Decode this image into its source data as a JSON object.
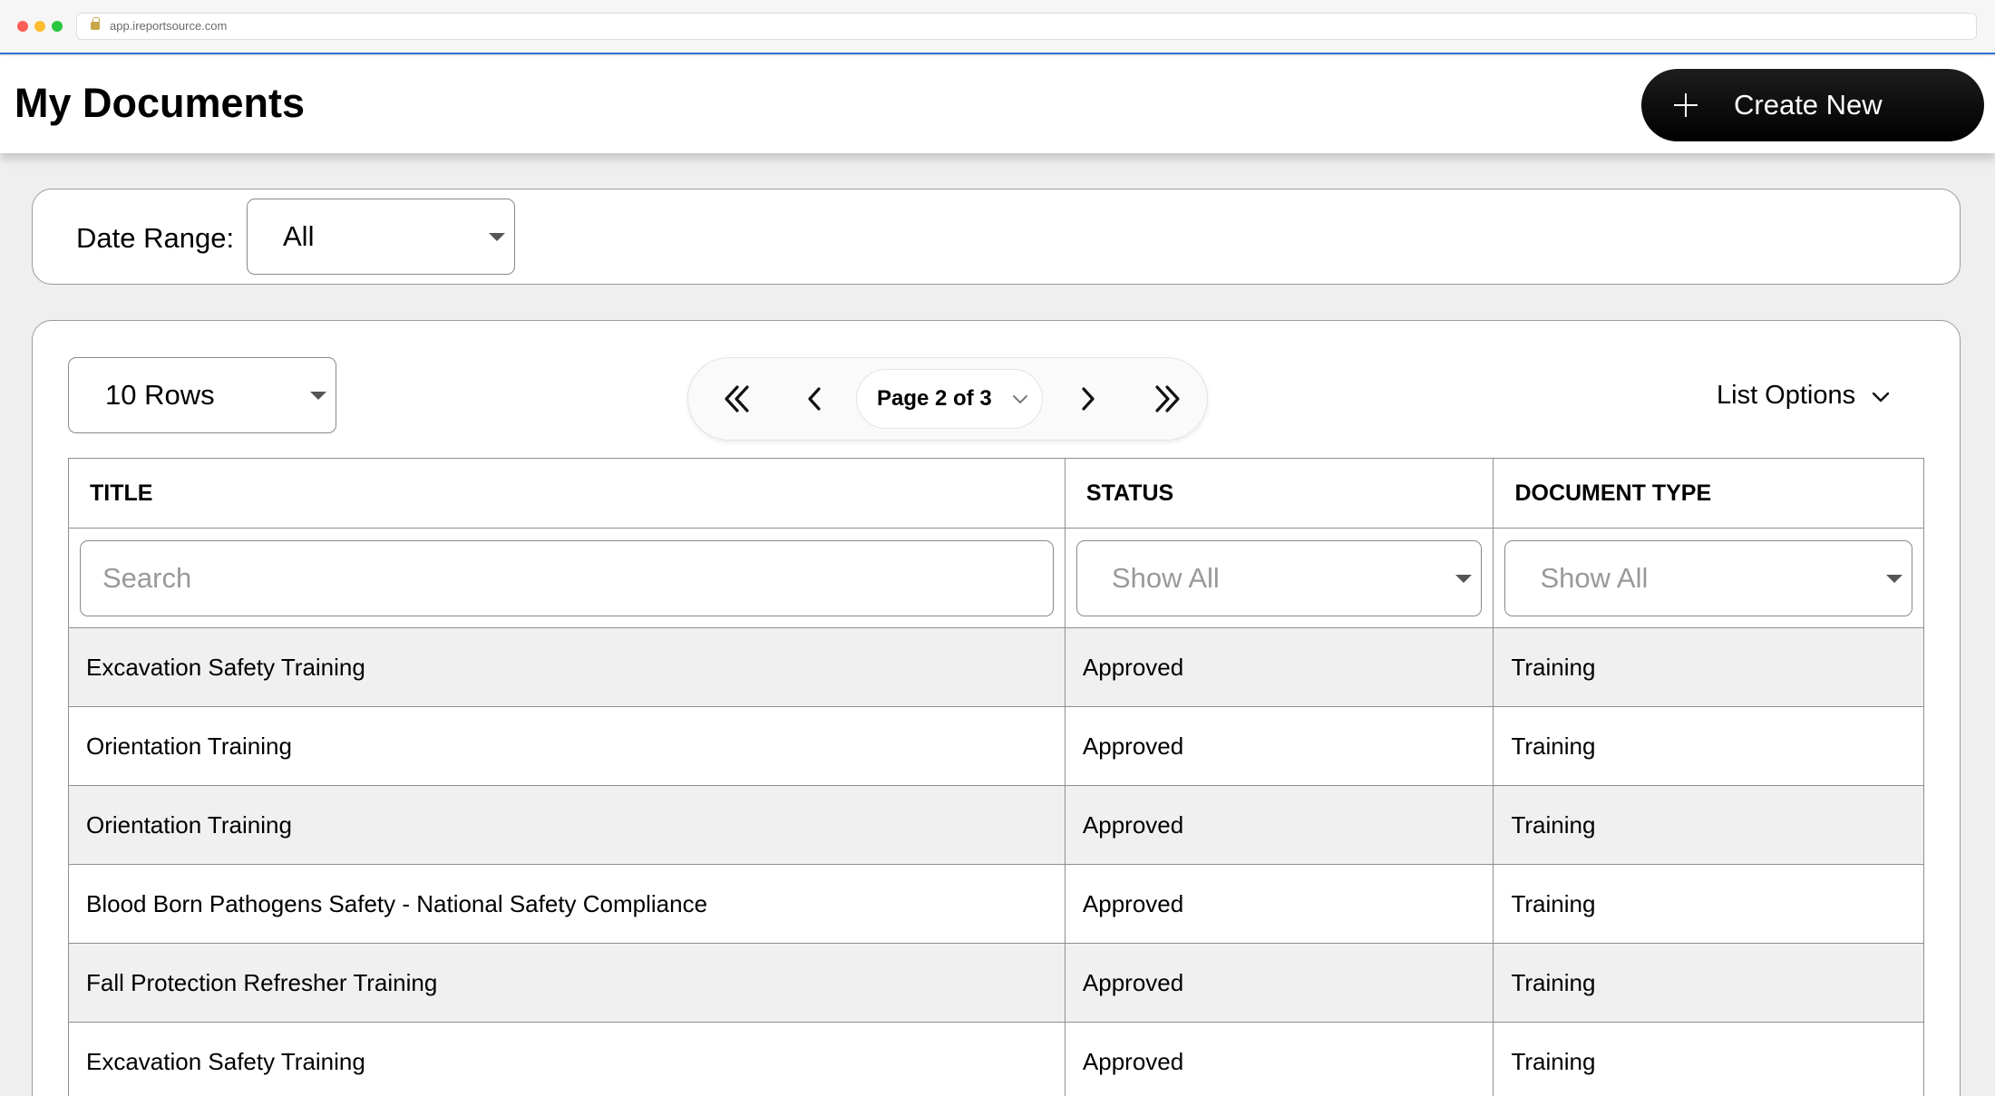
{
  "browser": {
    "url": "app.ireportsource.com"
  },
  "header": {
    "title": "My Documents",
    "create_label": "Create New"
  },
  "filters": {
    "date_range_label": "Date Range:",
    "date_range_value": "All"
  },
  "list": {
    "rows_per_page": "10 Rows",
    "page_indicator": "Page 2 of 3",
    "list_options_label": "List Options",
    "columns": [
      "TITLE",
      "STATUS",
      "DOCUMENT TYPE"
    ],
    "search_placeholder": "Search",
    "status_filter": "Show All",
    "type_filter": "Show All",
    "rows": [
      {
        "title": "Excavation Safety Training",
        "status": "Approved",
        "type": "Training"
      },
      {
        "title": "Orientation Training",
        "status": "Approved",
        "type": "Training"
      },
      {
        "title": "Orientation Training",
        "status": "Approved",
        "type": "Training"
      },
      {
        "title": "Blood Born Pathogens Safety - National Safety Compliance",
        "status": "Approved",
        "type": "Training"
      },
      {
        "title": "Fall Protection Refresher Training",
        "status": "Approved",
        "type": "Training"
      },
      {
        "title": "Excavation Safety Training",
        "status": "Approved",
        "type": "Training"
      }
    ]
  },
  "icons": {
    "lock": "lock-icon",
    "plus": "plus-icon",
    "first": "double-chevron-left-icon",
    "prev": "chevron-left-icon",
    "next": "chevron-right-icon",
    "last": "double-chevron-right-icon",
    "dropdown": "chevron-down-icon",
    "caret": "caret-down-icon"
  },
  "colors": {
    "accent_line": "#2f6fd1",
    "button_bg": "#000000",
    "alt_row": "#f0f0f0"
  }
}
